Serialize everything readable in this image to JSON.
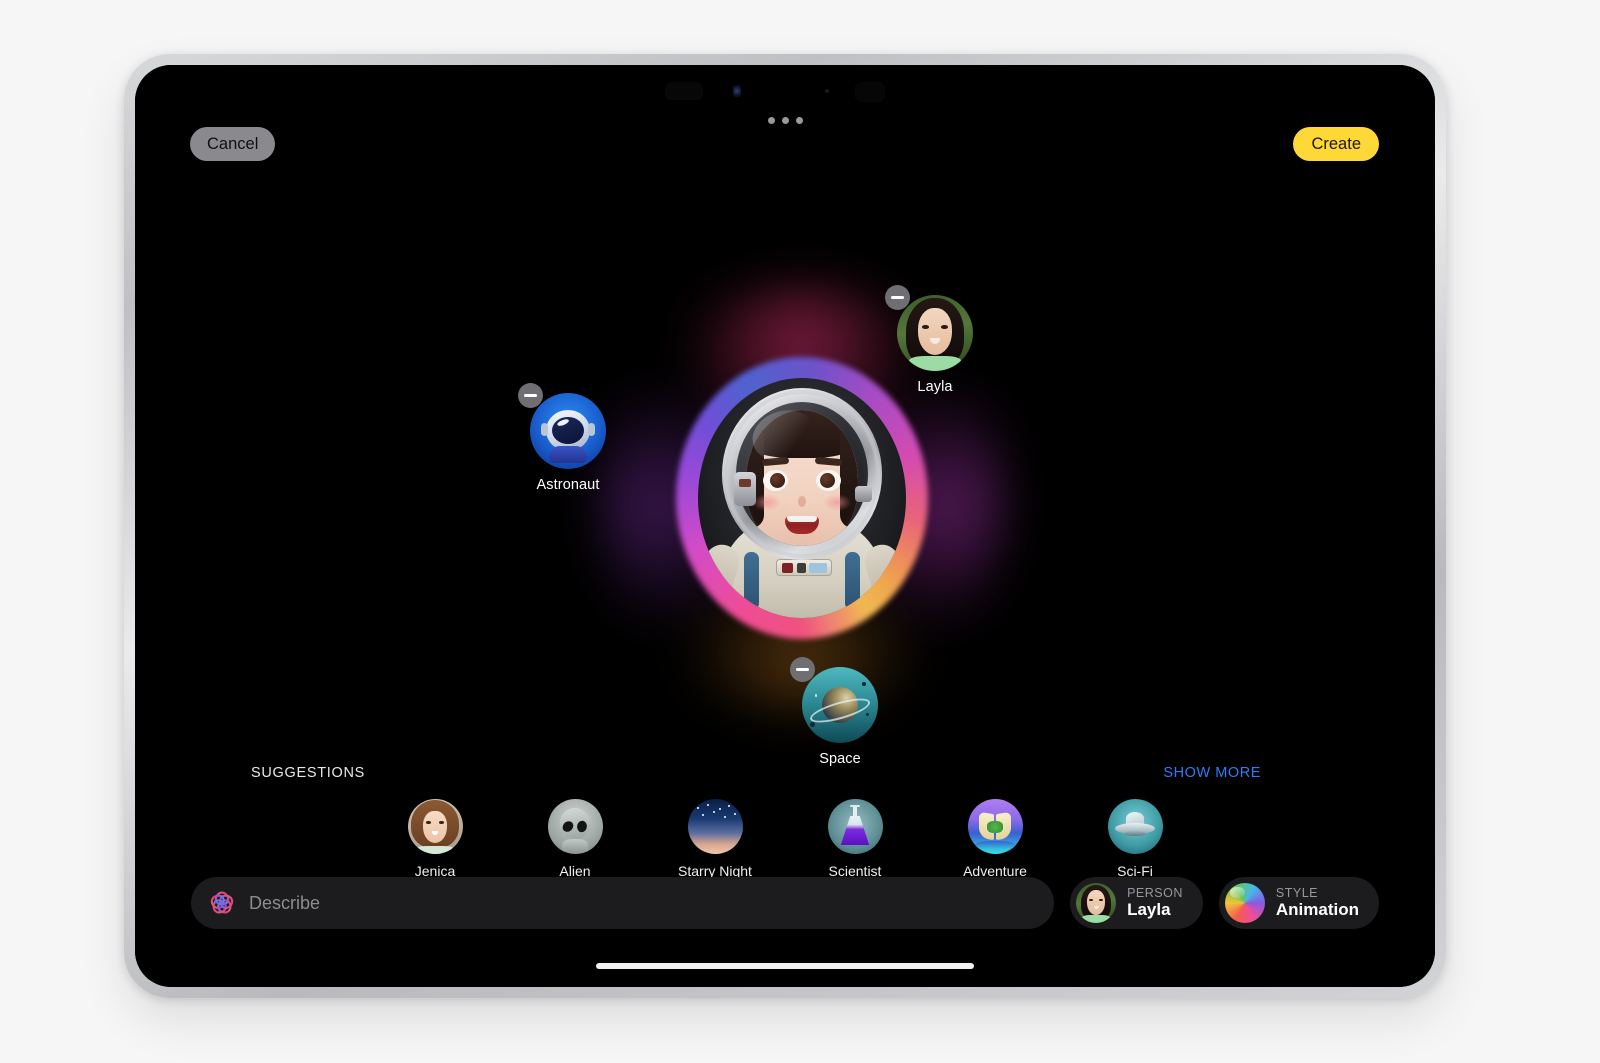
{
  "app": {
    "screen_name": "Image Playground",
    "background_color": "#f6f6f7",
    "screen_background": "#000000"
  },
  "topbar": {
    "cancel_label": "Cancel",
    "create_label": "Create",
    "cancel_color": "#8a8a8e",
    "create_color": "#FDD836"
  },
  "canvas": {
    "main_image_alt": "Animated astronaut portrait of Layla",
    "tokens": [
      {
        "label": "Astronaut",
        "icon": "astronaut-helmet-icon",
        "remove_label": "Remove"
      },
      {
        "label": "Layla",
        "icon": "person-photo-icon",
        "remove_label": "Remove"
      },
      {
        "label": "Space",
        "icon": "planet-icon",
        "remove_label": "Remove"
      }
    ]
  },
  "suggestions": {
    "title": "SUGGESTIONS",
    "show_more_label": "SHOW MORE",
    "show_more_color": "#2a7dfb",
    "items": [
      {
        "label": "Jenica",
        "icon": "person-photo-icon"
      },
      {
        "label": "Alien",
        "icon": "alien-icon"
      },
      {
        "label": "Starry Night",
        "icon": "starry-sky-icon"
      },
      {
        "label": "Scientist",
        "icon": "flask-icon"
      },
      {
        "label": "Adventure",
        "icon": "map-icon"
      },
      {
        "label": "Sci-Fi",
        "icon": "ufo-icon"
      }
    ]
  },
  "composer": {
    "describe_placeholder": "Describe",
    "describe_value": "",
    "ai_icon": "apple-intelligence-icon",
    "person_chip": {
      "kicker": "PERSON",
      "value": "Layla",
      "icon": "person-photo-icon"
    },
    "style_chip": {
      "kicker": "STYLE",
      "value": "Animation",
      "icon": "style-ball-icon"
    }
  }
}
